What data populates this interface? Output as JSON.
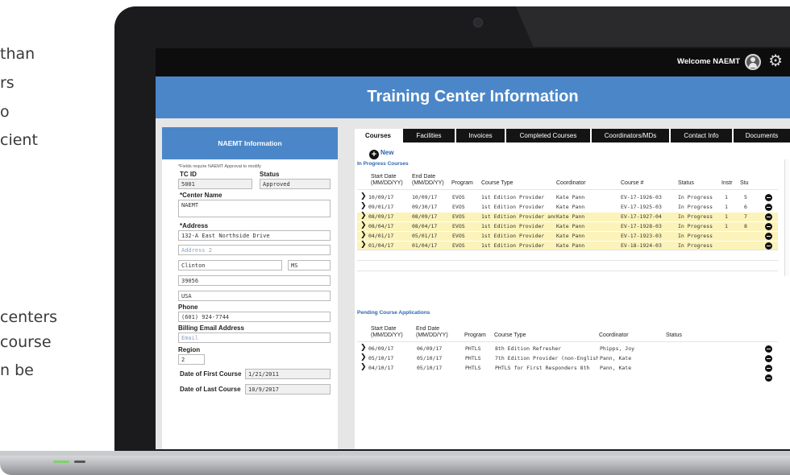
{
  "side_text": [
    "than",
    "rs",
    "o",
    "cient",
    "centers",
    "course",
    "n be"
  ],
  "topbar": {
    "welcome": "Welcome NAEMT",
    "user_icon": "user-icon",
    "gear_icon": "gear-icon"
  },
  "page_title": "Training Center Information",
  "left_panel": {
    "title": "NAEMT Information",
    "note": "*Fields require NAEMT Approval to modify",
    "tc_id_label": "TC ID",
    "tc_id": "5001",
    "status_label": "Status",
    "status": "Approved",
    "center_name_label": "*Center Name",
    "center_name": "NAEMT",
    "address_label": "*Address",
    "address1": "132-A East Northside Drive",
    "address2_placeholder": "Address 2",
    "city": "Clinton",
    "state": "MS",
    "zip": "39056",
    "country": "USA",
    "phone_label": "Phone",
    "phone": "(601) 924-7744",
    "billing_email_label": "Billing Email Address",
    "billing_email_placeholder": "Email",
    "region_label": "Region",
    "region": "2",
    "first_course_label": "Date of First Course",
    "first_course": "1/21/2011",
    "last_course_label": "Date of Last Course",
    "last_course": "10/9/2017"
  },
  "tabs": [
    "Courses",
    "Facilities",
    "Invoices",
    "Completed Courses",
    "Coordinators/MDs",
    "Contact Info",
    "Documents"
  ],
  "new_label": "New",
  "in_progress": {
    "title": "In Progress Courses",
    "columns": {
      "start_date": [
        "Start Date",
        "(MM/DD/YY)"
      ],
      "end_date": [
        "End Date",
        "(MM/DD/YY)"
      ],
      "program": "Program",
      "course_type": "Course Type",
      "coordinator": "Coordinator",
      "course_num": "Course #",
      "status": "Status",
      "instr": "Instr",
      "stu": "Stu"
    },
    "rows": [
      {
        "start": "10/09/17",
        "end": "10/09/17",
        "program": "EVOS",
        "type": "1st Edition Provider",
        "coordinator": "Kate Pann",
        "course": "EV-17-1926-03",
        "status": "In Progress",
        "instr": "1",
        "stu": "5",
        "highlight": false
      },
      {
        "start": "09/01/17",
        "end": "09/30/17",
        "program": "EVOS",
        "type": "1st Edition Provider",
        "coordinator": "Kate Pann",
        "course": "EV-17-1925-03",
        "status": "In Progress",
        "instr": "1",
        "stu": "6",
        "highlight": false
      },
      {
        "start": "08/09/17",
        "end": "08/09/17",
        "program": "EVOS",
        "type": "1st Edition Provider and",
        "coordinator": "Kate Pann",
        "course": "EV-17-1927-04",
        "status": "In Progress",
        "instr": "1",
        "stu": "7",
        "highlight": true
      },
      {
        "start": "08/04/17",
        "end": "08/04/17",
        "program": "EVOS",
        "type": "1st Edition Provider",
        "coordinator": "Kate Pann",
        "course": "EV-17-1928-03",
        "status": "In Progress",
        "instr": "1",
        "stu": "8",
        "highlight": true
      },
      {
        "start": "04/01/17",
        "end": "05/01/17",
        "program": "EVOS",
        "type": "1st Edition Provider",
        "coordinator": "Kate Pann",
        "course": "EV-17-1923-03",
        "status": "In Progress",
        "instr": "",
        "stu": "",
        "highlight": true
      },
      {
        "start": "01/04/17",
        "end": "01/04/17",
        "program": "EVOS",
        "type": "1st Edition Provider",
        "coordinator": "Kate Pann",
        "course": "EV-18-1924-03",
        "status": "In Progress",
        "instr": "",
        "stu": "",
        "highlight": true
      }
    ]
  },
  "pending": {
    "title": "Pending Course Applications",
    "columns": {
      "start_date": [
        "Start Date",
        "(MM/DD/YY)"
      ],
      "end_date": [
        "End Date",
        "(MM/DD/YY)"
      ],
      "program": "Program",
      "course_type": "Course Type",
      "coordinator": "Coordinator",
      "status": "Status"
    },
    "rows": [
      {
        "start": "06/09/17",
        "end": "06/09/17",
        "program": "PHTLS",
        "type": "8th Edition Refresher",
        "coordinator": "Phipps, Joy"
      },
      {
        "start": "05/10/17",
        "end": "05/10/17",
        "program": "PHTLS",
        "type": "7th Edition Provider (non-English",
        "coordinator": "Pann, Kate"
      },
      {
        "start": "04/10/17",
        "end": "05/10/17",
        "program": "PHTLS",
        "type": "PHTLS for First Responders 8th",
        "coordinator": "Pann, Kate"
      }
    ]
  },
  "colors": {
    "accent_blue": "#4b87c8",
    "topbar": "#0d0d0d",
    "highlight_row": "#fbf3ba",
    "section_title": "#2d66b0"
  }
}
